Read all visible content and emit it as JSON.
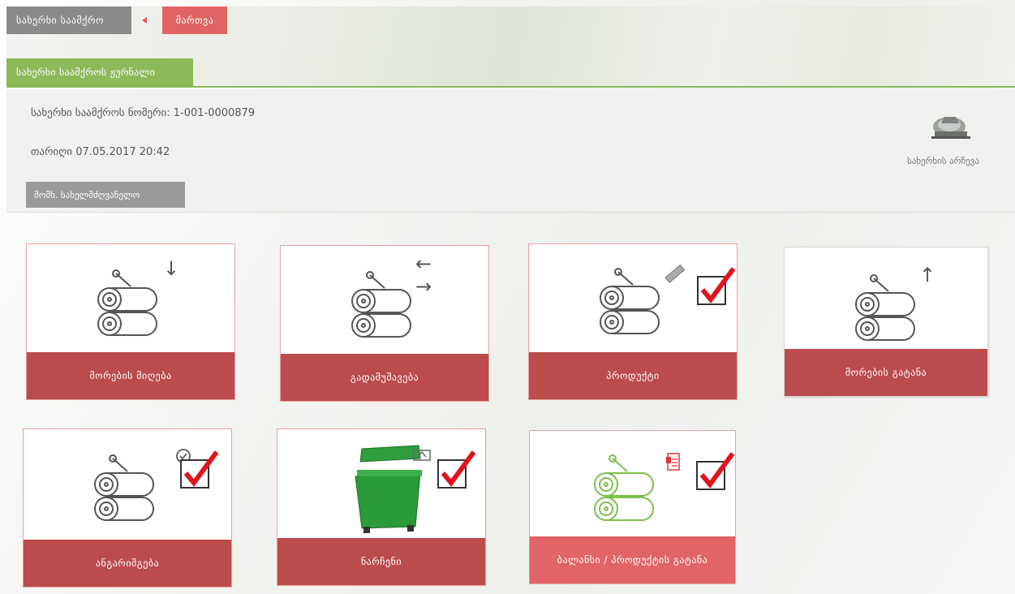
{
  "breadcrumb": {
    "home": "სახერხი საამქრო",
    "current": "მართვა"
  },
  "journal_tab": "სახერხი საამქროს ჟურნალი",
  "info": {
    "number_label": "სახერხი საამქროს ნომერი:",
    "number_value": "1-001-0000879",
    "date_label": "თარიღი",
    "date_value": "07.05.2017 20:42",
    "responsible_button": "მომხ. სახელმძღვანელო"
  },
  "saw": {
    "icon": "circular-saw-icon",
    "label": "სახერხის არჩევა"
  },
  "tiles": [
    {
      "label": "მორების მიღება",
      "icon": "logs-icon",
      "badge": "arrow-down-icon"
    },
    {
      "label": "გადამუშავება",
      "icon": "logs-icon",
      "badge": "arrows-exchange-icon"
    },
    {
      "label": "პროდუქტი",
      "icon": "logs-icon",
      "badge": "plank-icon",
      "checked": true
    },
    {
      "label": "მორების გატანა",
      "icon": "logs-icon",
      "badge": "arrow-up-icon"
    },
    {
      "label": "ანგარიშგება",
      "icon": "logs-icon",
      "badge": "clock-check-icon",
      "checked": true
    },
    {
      "label": "ნარჩენი",
      "icon": "waste-container-icon",
      "badge": "scale-icon",
      "checked": true
    },
    {
      "label": "ბალანსი / პროდუქტის გატანა",
      "icon": "logs-icon-green",
      "badge": "document-icon",
      "checked": true
    }
  ],
  "colors": {
    "accent_red": "#bc4b4e",
    "accent_green": "#8cba58",
    "check_red": "#e0141e"
  }
}
